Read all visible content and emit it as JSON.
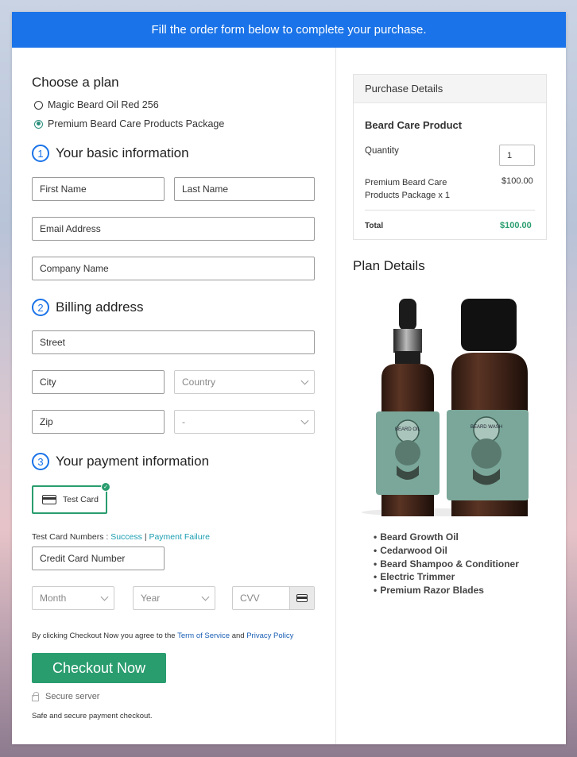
{
  "banner": {
    "text": "Fill the order form below to complete your purchase."
  },
  "plan": {
    "heading": "Choose a plan",
    "options": [
      {
        "label": "Magic Beard Oil Red 256",
        "selected": false
      },
      {
        "label": "Premium Beard Care Products Package",
        "selected": true
      }
    ]
  },
  "steps": [
    {
      "num": "1",
      "title": "Your basic information"
    },
    {
      "num": "2",
      "title": "Billing address"
    },
    {
      "num": "3",
      "title": "Your payment information"
    }
  ],
  "basic": {
    "first_name": "First Name",
    "last_name": "Last Name",
    "email": "Email Address",
    "company": "Company Name"
  },
  "billing": {
    "street": "Street",
    "city": "City",
    "country": "Country",
    "zip": "Zip",
    "state": "-"
  },
  "payment": {
    "card_label": "Test Card",
    "test_numbers_label": "Test Card Numbers :",
    "success_link": "Success",
    "separator": "|",
    "failure_link": "Payment Failure",
    "card_number": "Credit Card Number",
    "month": "Month",
    "year": "Year",
    "cvv": "CVV"
  },
  "terms": {
    "prefix": "By clicking Checkout Now you agree to the",
    "tos": "Term of Service",
    "and": "and",
    "privacy": "Privacy Policy"
  },
  "checkout": {
    "button": "Checkout Now",
    "secure": "Secure server",
    "note": "Safe and secure payment checkout."
  },
  "purchase": {
    "heading": "Purchase Details",
    "product": "Beard Care Product",
    "quantity_label": "Quantity",
    "quantity_value": "1",
    "line_item_1": "Premium Beard Care",
    "line_item_2": "Products Package x 1",
    "line_price": "$100.00",
    "total_label": "Total",
    "total_value": "$100.00"
  },
  "plan_details": {
    "heading": "Plan Details",
    "bottle_small_label_1": "BEARD OIL",
    "bottle_large_label_1": "BEARD WASH",
    "items": [
      "Beard Growth Oil",
      "Cedarwood Oil",
      "Beard Shampoo & Conditioner",
      "Electric Trimmer",
      "Premium Razor Blades"
    ]
  },
  "colors": {
    "accent": "#1a73e8",
    "success": "#2a9d6f",
    "total": "#2a9d6f"
  }
}
